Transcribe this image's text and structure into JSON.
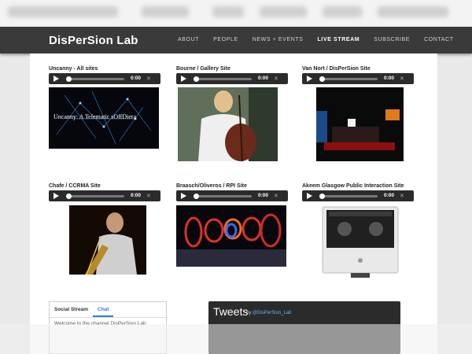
{
  "app": {
    "brand": "DisPerSion Lab"
  },
  "nav": {
    "items": [
      "ABOUT",
      "PEOPLE",
      "NEWS + EVENTS",
      "LIVE STREAM",
      "SUBSCRIBE",
      "CONTACT"
    ],
    "active": "LIVE STREAM"
  },
  "streams": [
    {
      "title": "Uncanny - All sites",
      "time": "0:00",
      "thumb_text": "Uncanny: A Telematic sOffDiera"
    },
    {
      "title": "Bourne / Gallery Site",
      "time": "0:00"
    },
    {
      "title": "Van Nort / DisPerSion Site",
      "time": "0:00"
    },
    {
      "title": "Chafe / CCRMA Site",
      "time": "0:00"
    },
    {
      "title": "Braasch/Oliveros / RPI Site",
      "time": "0:00"
    },
    {
      "title": "Akeem Glasgow Public Interaction Site",
      "time": "0:00"
    }
  ],
  "social": {
    "tabs": [
      "Social Stream",
      "Chat"
    ],
    "active_tab": "Chat",
    "message": "Welcome to the channel DisPerSion Lab"
  },
  "tweets": {
    "title": "Tweets",
    "by_prefix": "by",
    "handle": "@DisPerSion_Lab"
  }
}
